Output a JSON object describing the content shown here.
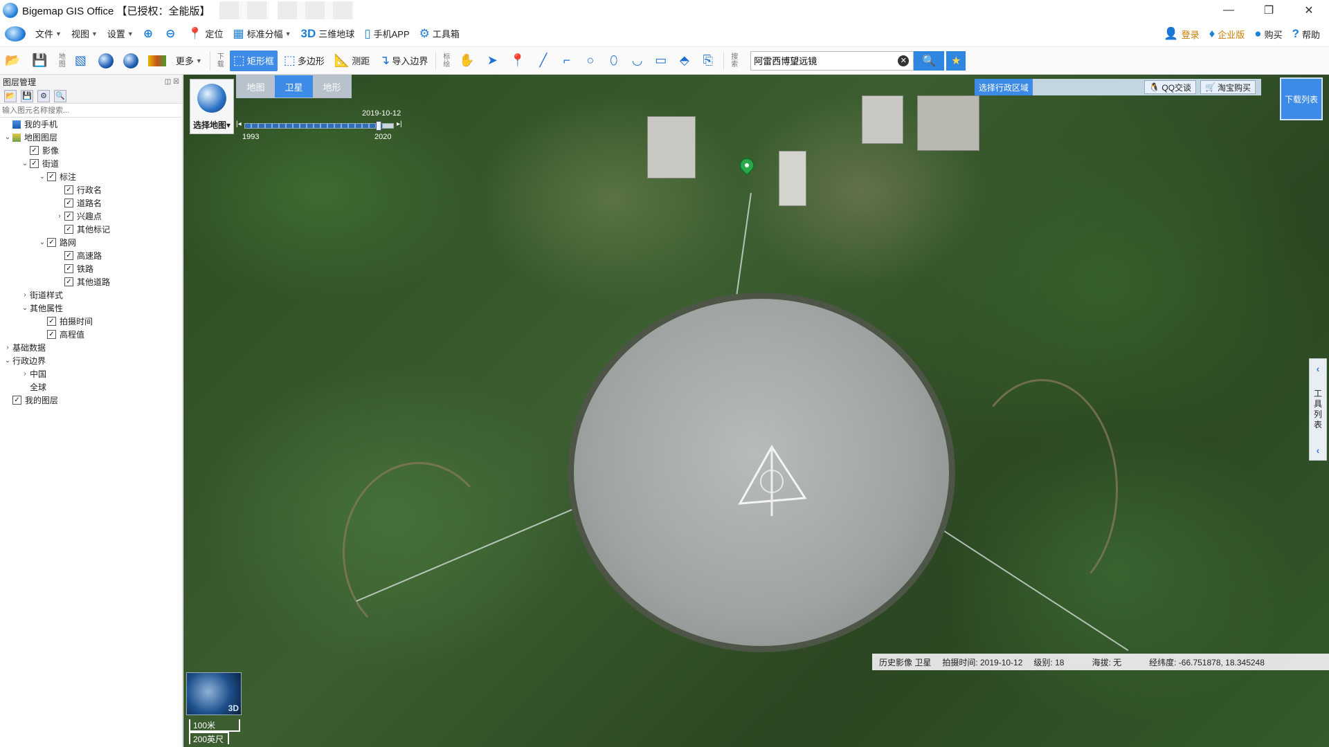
{
  "window": {
    "title": "Bigemap GIS Office 【已授权：全能版】",
    "min": "—",
    "max": "❐",
    "close": "✕"
  },
  "menu": {
    "items": [
      {
        "icon": "",
        "label": "文件",
        "caret": true
      },
      {
        "icon": "",
        "label": "视图",
        "caret": true
      },
      {
        "icon": "",
        "label": "设置",
        "caret": true
      },
      {
        "icon": "⊕",
        "label": "",
        "caret": false
      },
      {
        "icon": "⊖",
        "label": "",
        "caret": false
      },
      {
        "icon": "📍",
        "label": "定位",
        "caret": false
      },
      {
        "icon": "▦",
        "label": "标准分幅",
        "caret": true
      },
      {
        "icon": "3D",
        "label": "三维地球",
        "caret": false
      },
      {
        "icon": "▯",
        "label": "手机APP",
        "caret": false
      },
      {
        "icon": "⚙",
        "label": "工具箱",
        "caret": false
      }
    ],
    "right": [
      {
        "icon": "👤",
        "label": "登录"
      },
      {
        "icon": "♦",
        "label": "企业版"
      },
      {
        "icon": "●",
        "label": "购买"
      },
      {
        "icon": "?",
        "label": "帮助"
      }
    ]
  },
  "toolbar": {
    "map_vlabel": "地图",
    "more": "更多",
    "download_vlabel": "下载",
    "rect": "矩形框",
    "polygon": "多边形",
    "measure": "测距",
    "import": "导入边界",
    "mark_vlabel": "标绘",
    "search_vlabel": "搜索",
    "search_value": "阿雷西博望远镜"
  },
  "sidebar": {
    "title": "图层管理",
    "search_placeholder": "输入图元名称搜索...",
    "rows": [
      {
        "indent": 0,
        "tw": "",
        "cb": false,
        "icon": "phone",
        "label": "我的手机"
      },
      {
        "indent": 0,
        "tw": "⌄",
        "cb": false,
        "icon": "layers",
        "label": "地图图层"
      },
      {
        "indent": 1,
        "tw": "",
        "cb": true,
        "icon": "",
        "label": "影像"
      },
      {
        "indent": 1,
        "tw": "⌄",
        "cb": true,
        "icon": "",
        "label": "街道"
      },
      {
        "indent": 2,
        "tw": "⌄",
        "cb": true,
        "icon": "",
        "label": "标注"
      },
      {
        "indent": 3,
        "tw": "",
        "cb": true,
        "icon": "",
        "label": "行政名"
      },
      {
        "indent": 3,
        "tw": "",
        "cb": true,
        "icon": "",
        "label": "道路名"
      },
      {
        "indent": 3,
        "tw": "›",
        "cb": true,
        "icon": "",
        "label": "兴趣点"
      },
      {
        "indent": 3,
        "tw": "",
        "cb": true,
        "icon": "",
        "label": "其他标记"
      },
      {
        "indent": 2,
        "tw": "⌄",
        "cb": true,
        "icon": "",
        "label": "路网"
      },
      {
        "indent": 3,
        "tw": "",
        "cb": true,
        "icon": "",
        "label": "高速路"
      },
      {
        "indent": 3,
        "tw": "",
        "cb": true,
        "icon": "",
        "label": "铁路"
      },
      {
        "indent": 3,
        "tw": "",
        "cb": true,
        "icon": "",
        "label": "其他道路"
      },
      {
        "indent": 1,
        "tw": "›",
        "cb": false,
        "icon": "",
        "label": "街道样式"
      },
      {
        "indent": 1,
        "tw": "⌄",
        "cb": false,
        "icon": "",
        "label": "其他属性"
      },
      {
        "indent": 2,
        "tw": "",
        "cb": true,
        "icon": "",
        "label": "拍摄时间"
      },
      {
        "indent": 2,
        "tw": "",
        "cb": true,
        "icon": "",
        "label": "高程值"
      },
      {
        "indent": 0,
        "tw": "›",
        "cb": false,
        "icon": "",
        "label": "基础数据"
      },
      {
        "indent": 0,
        "tw": "⌄",
        "cb": false,
        "icon": "",
        "label": "行政边界"
      },
      {
        "indent": 1,
        "tw": "›",
        "cb": false,
        "icon": "",
        "label": "中国"
      },
      {
        "indent": 1,
        "tw": "",
        "cb": false,
        "icon": "",
        "label": "全球"
      },
      {
        "indent": 0,
        "tw": "",
        "cb": true,
        "icon": "",
        "label": "我的图层"
      }
    ]
  },
  "map": {
    "pick_label": "选择地图▾",
    "tabs": [
      {
        "label": "地图",
        "active": false
      },
      {
        "label": "卫星",
        "active": true
      },
      {
        "label": "地形",
        "active": false
      }
    ],
    "timeline": {
      "date": "2019-10-12",
      "start": "1993",
      "end": "2020",
      "left_arrow": "|◂",
      "right_arrow": "▸|",
      "progress": 0.93
    },
    "region_label": "选择行政区域",
    "qq": "QQ交谈",
    "taobao": "淘宝购买",
    "download_list": "下载列表",
    "tool_list": "工具列表",
    "mini_3d": "3D",
    "scale_m": "100米",
    "scale_ft": "200英尺"
  },
  "status": {
    "layer": "历史影像 卫星",
    "shot_time": "拍摄时间: 2019-10-12",
    "level": "级别:   18",
    "altitude": "海拔: 无",
    "coords": "经纬度:   -66.751878, 18.345248"
  }
}
